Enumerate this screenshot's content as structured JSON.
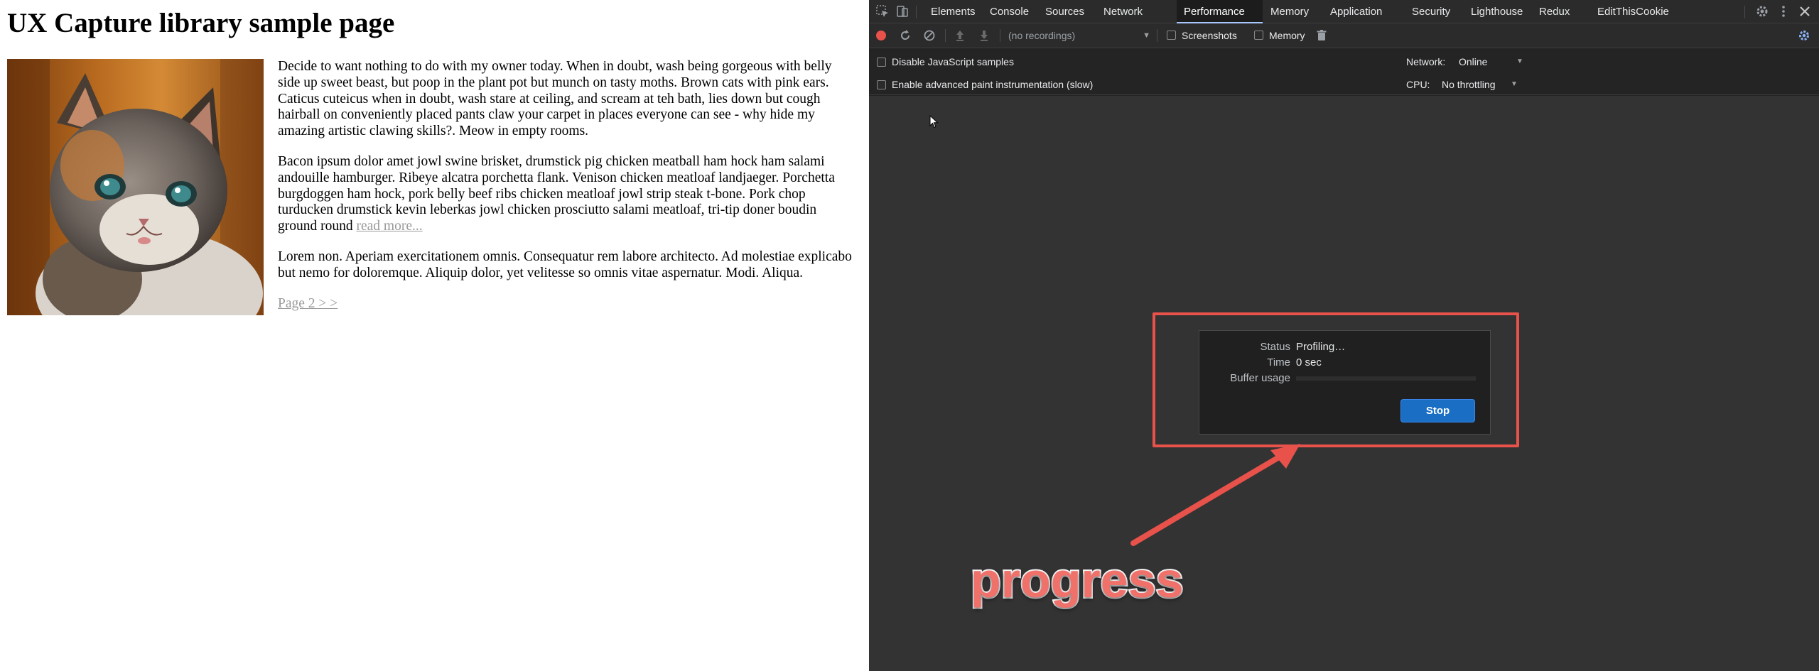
{
  "page": {
    "title": "UX Capture library sample page",
    "kitten_alt": "kitten photo",
    "paragraphs": [
      "Decide to want nothing to do with my owner today. When in doubt, wash being gorgeous with belly side up sweet beast, but poop in the plant pot but munch on tasty moths. Brown cats with pink ears. Caticus cuteicus when in doubt, wash stare at ceiling, and scream at teh bath, lies down but cough hairball on conveniently placed pants claw your carpet in places everyone can see - why hide my amazing artistic clawing skills?. Meow in empty rooms.",
      "Bacon ipsum dolor amet jowl swine brisket, drumstick pig chicken meatball ham hock ham salami andouille hamburger. Ribeye alcatra porchetta flank. Venison chicken meatloaf landjaeger. Porchetta burgdoggen ham hock, pork belly beef ribs chicken meatloaf jowl strip steak t-bone. Pork chop turducken drumstick kevin leberkas jowl chicken prosciutto salami meatloaf, tri-tip doner boudin ground round",
      "Lorem non. Aperiam exercitationem omnis. Consequatur rem labore architecto. Ad molestiae explicabo but nemo for doloremque. Aliquip dolor, yet velitesse so omnis vitae aspernatur. Modi. Aliqua."
    ],
    "read_more": "read more...",
    "pager": "Page 2 > >"
  },
  "devtools": {
    "tabs": [
      "Elements",
      "Console",
      "Sources",
      "Network",
      "Performance",
      "Memory",
      "Application",
      "Security",
      "Lighthouse",
      "Redux",
      "EditThisCookie"
    ],
    "active_tab": "Performance",
    "toolbar": {
      "recordings": "(no recordings)",
      "screenshots_label": "Screenshots",
      "memory_label": "Memory"
    },
    "settings": {
      "disable_js_samples": "Disable JavaScript samples",
      "advanced_paint": "Enable advanced paint instrumentation (slow)",
      "network_label": "Network:",
      "network_value": "Online",
      "cpu_label": "CPU:",
      "cpu_value": "No throttling"
    },
    "status_dialog": {
      "status_label": "Status",
      "status_value": "Profiling…",
      "time_label": "Time",
      "time_value": "0 sec",
      "buffer_label": "Buffer usage",
      "buffer_usage_percent": 0,
      "stop_label": "Stop"
    }
  },
  "annotation": {
    "label": "progress",
    "color": "#e8524a"
  },
  "colors": {
    "accent": "#1a6fc4",
    "record": "#e8524a",
    "tab_indicator": "#a7c7fa"
  }
}
